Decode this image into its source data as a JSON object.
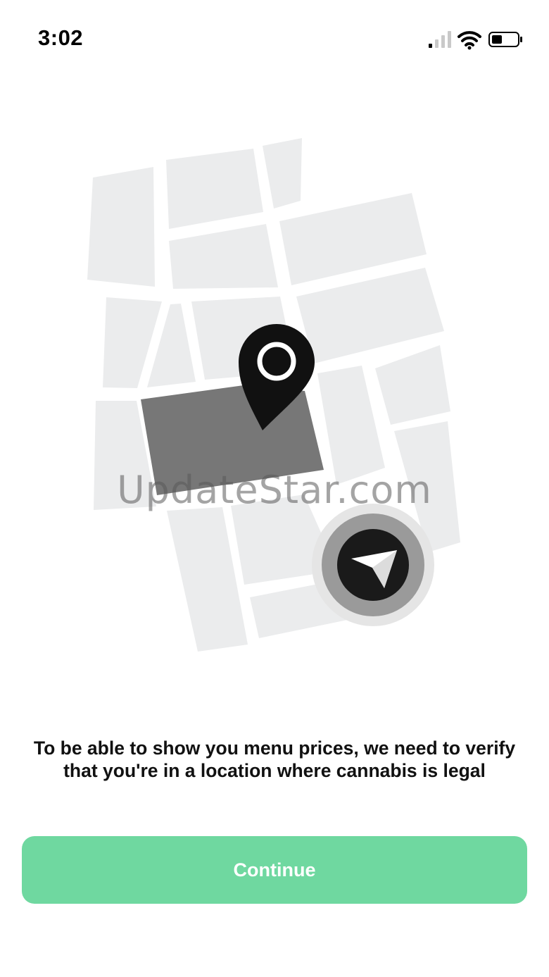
{
  "status_bar": {
    "time": "3:02",
    "icons": [
      "cellular-signal-icon",
      "wifi-icon",
      "battery-icon"
    ]
  },
  "illustration": {
    "icons": [
      "map-illustration",
      "location-pin-icon",
      "navigation-arrow-icon"
    ]
  },
  "watermark": "UpdateStar.com",
  "message": "To be able to show you menu prices, we need to verify that you're in a location where cannabis is legal",
  "continue_button": {
    "label": "Continue"
  },
  "colors": {
    "accent": "#6fd8a0",
    "map_block": "#ebeced",
    "highlight_block": "#777777",
    "pin": "#111111"
  }
}
